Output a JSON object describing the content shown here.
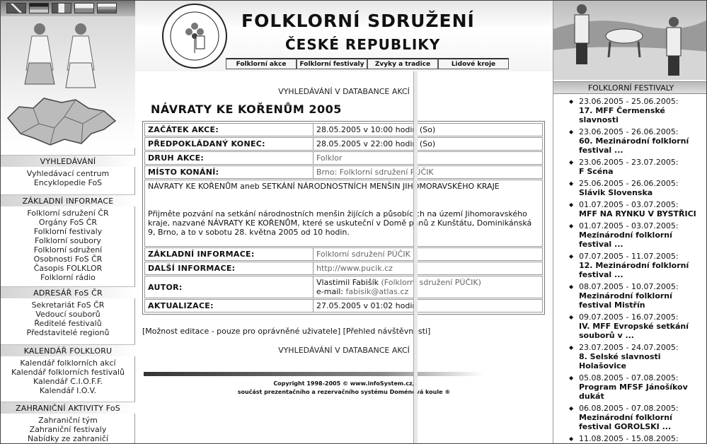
{
  "left": {
    "sections": [
      {
        "title": "VYHLEDÁVÁNÍ",
        "items": [
          "Vyhledávací centrum",
          "Encyklopedie FoS"
        ]
      },
      {
        "title": "ZÁKLADNÍ INFORMACE",
        "items": [
          "Folklorní sdružení ČR",
          "Orgány FoS ČR",
          "Folklorní festivaly",
          "Folklorní soubory",
          "Folklorní sdružení",
          "Osobnosti FoS ČR",
          "Časopis FOLKLOR",
          "Folklorní rádio"
        ]
      },
      {
        "title": "ADRESÁŘ FoS ČR",
        "items": [
          "Sekretariát FoS ČR",
          "Vedoucí souborů",
          "Ředitelé festivalů",
          "Představitelé regionů"
        ]
      },
      {
        "title": "KALENDÁŘ FOLKLORU",
        "items": [
          "Kalendář folklorních akcí",
          "Kalendář folklorních festivalů",
          "Kalendář C.I.O.F.F.",
          "Kalendář I.O.V."
        ]
      },
      {
        "title": "ZAHRANIČNÍ AKTIVITY FoS",
        "items": [
          "Zahraniční tým",
          "Zahraniční festivaly",
          "Nabídky ze zahraničí"
        ]
      }
    ]
  },
  "header": {
    "logo_text": "FOLKLORNÍ SDRUŽENÍ ČESKÉ REPUBLIKY",
    "title1": "FOLKLORNÍ SDRUŽENÍ",
    "title2": "ČESKÉ REPUBLIKY",
    "tabs": [
      "Folklorní akce",
      "Folklorní festivaly",
      "Zvyky a tradice",
      "Lidové kroje"
    ]
  },
  "main": {
    "search_link": "VYHLEDÁVÁNÍ V DATABANCE AKCÍ",
    "event_title": "NÁVRATY KE KOŘENŮM 2005",
    "rows": [
      {
        "label": "ZAČÁTEK AKCE:",
        "value": "28.05.2005 v 10:00 hodin (So)"
      },
      {
        "label": "PŘEDPOKLÁDANÝ KONEC:",
        "value": "28.05.2005 v 22:00 hodin (So)"
      },
      {
        "label": "DRUH AKCE:",
        "value": "Folklor"
      },
      {
        "label": "MÍSTO KONÁNÍ:",
        "value": "Brno: Folklorní sdružení PÚČIK"
      }
    ],
    "desc_title": "NÁVRATY KE KOŘENŮM aneb SETKÁNÍ NÁRODNOSTNÍCH MENŠIN JIHOMORAVSKÉHO KRAJE",
    "desc_body": "Přijměte pozvání na setkání národnostních menšin žijících a působících na území Jihomoravského kraje, nazvané NÁVRATY KE KOŘENŮM, které se uskuteční v Domě pánů z Kunštátu, Dominikánská 9, Brno, a to v sobotu 28. května 2005 od 10 hodin.",
    "basic_label": "ZÁKLADNÍ INFORMACE:",
    "basic_value": "Folklorní sdružení PÚČIK",
    "more_label": "DALŠÍ INFORMACE:",
    "more_value": "http://www.pucik.cz",
    "author_label": "AUTOR:",
    "author_name": "Vlastimil Fabišík",
    "author_org": "(Folklorní sdružení PÚČIK)",
    "author_email_label": "e-mail:",
    "author_email": "fabisik@atlas.cz",
    "update_label": "AKTUALIZACE:",
    "update_value": "27.05.2005 v 01:02 hodin",
    "edit_link": "Možnost editace - pouze pro oprávněné uživatele",
    "visits_link": "Přehled návštěvnosti",
    "copyright1": "Copyright 1998-2005 © www.infoSystem.cz,",
    "copyright2": "součást prezentačního a rezervačního systému Doménová koule ®"
  },
  "right": {
    "title": "FOLKLORNÍ FESTIVALY",
    "festivals": [
      {
        "date": "23.06.2005 - 25.06.2005:",
        "name": "17. MFF Čermenské slavnosti"
      },
      {
        "date": "23.06.2005 - 26.06.2005:",
        "name": "60. Mezinárodní folklorní festival ..."
      },
      {
        "date": "23.06.2005 - 23.07.2005:",
        "name": "F Scéna"
      },
      {
        "date": "25.06.2005 - 26.06.2005:",
        "name": "Slávik Slovenska"
      },
      {
        "date": "01.07.2005 - 03.07.2005:",
        "name": "MFF NA RYNKU V BYSTŘICI"
      },
      {
        "date": "01.07.2005 - 03.07.2005:",
        "name": "Mezinárodní folklorní festival ..."
      },
      {
        "date": "07.07.2005 - 11.07.2005:",
        "name": "12. Mezinárodní folklorní festival ..."
      },
      {
        "date": "08.07.2005 - 10.07.2005:",
        "name": "Mezinárodní folklorní festival Mistřín"
      },
      {
        "date": "09.07.2005 - 16.07.2005:",
        "name": "IV. MFF Evropské setkání souborů v ..."
      },
      {
        "date": "23.07.2005 - 24.07.2005:",
        "name": "8. Selské slavnosti Holašovice"
      },
      {
        "date": "05.08.2005 - 07.08.2005:",
        "name": "Program MFSF Jánošíkov dukát"
      },
      {
        "date": "06.08.2005 - 07.08.2005:",
        "name": "Mezinárodní folklorní festival GOROLSKI ..."
      },
      {
        "date": "11.08.2005 - 15.08.2005:",
        "name": ""
      }
    ]
  }
}
